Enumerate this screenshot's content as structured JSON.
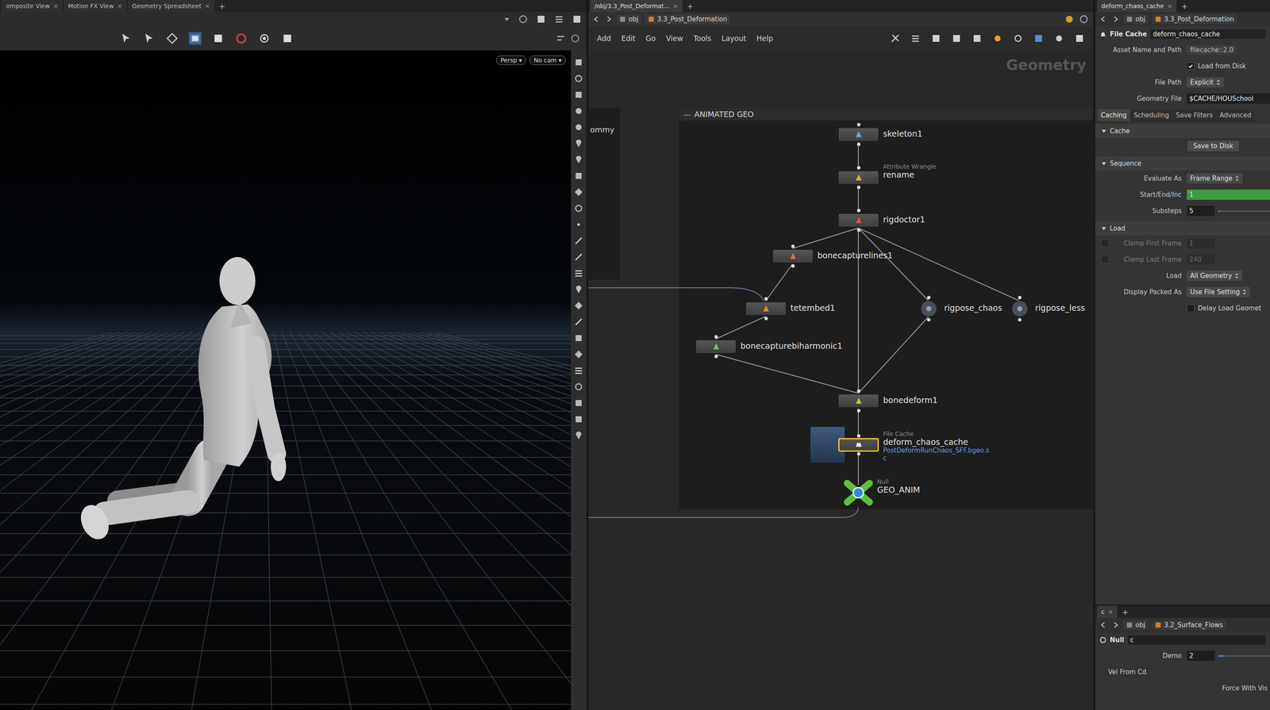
{
  "viewer_tabs": [
    {
      "label": "omposite View",
      "selected": false
    },
    {
      "label": "Motion FX View",
      "selected": false
    },
    {
      "label": "Geometry Spreadsheet",
      "selected": false
    }
  ],
  "tab_close": "×",
  "tab_add": "+",
  "viewport": {
    "view_buttons": [
      {
        "label": "Persp",
        "arrow": "▾"
      },
      {
        "label": "No cam",
        "arrow": "▾"
      }
    ]
  },
  "network": {
    "tab": {
      "label": "/obj/3.3_Post_Deformat...",
      "selected": true
    },
    "path": [
      "obj",
      "3.3_Post_Deformation"
    ],
    "menu": [
      "Add",
      "Edit",
      "Go",
      "View",
      "Tools",
      "Layout",
      "Help"
    ],
    "context": "Geometry",
    "boxes": [
      {
        "title": "ANIMATED GEO",
        "collapse": "—"
      },
      {
        "title": "ommy"
      }
    ],
    "nodes": [
      {
        "name": "skeleton1",
        "type": "",
        "kind": "box",
        "color": "#6fa8d8",
        "selected": false
      },
      {
        "name": "rename",
        "type": "Attribute Wrangle",
        "kind": "box",
        "color": "#e0b040",
        "selected": false
      },
      {
        "name": "rigdoctor1",
        "type": "",
        "kind": "box",
        "color": "#e05050",
        "selected": false
      },
      {
        "name": "bonecapturelines1",
        "type": "",
        "kind": "box",
        "color": "#e06a4a",
        "selected": false
      },
      {
        "name": "tetembed1",
        "type": "",
        "kind": "box",
        "color": "#e08a30",
        "selected": false
      },
      {
        "name": "rigpose_chaos",
        "type": "",
        "kind": "circle",
        "color": "#8aa0c0",
        "selected": false
      },
      {
        "name": "rigpose_less",
        "type": "",
        "kind": "circle",
        "color": "#8aa0c0",
        "selected": false
      },
      {
        "name": "bonecapturebiharmonic1",
        "type": "",
        "kind": "box",
        "color": "#7ac060",
        "selected": false
      },
      {
        "name": "bonedeform1",
        "type": "",
        "kind": "box",
        "color": "#b8c840",
        "selected": false
      },
      {
        "name": "deform_chaos_cache",
        "type": "File Cache",
        "kind": "cache",
        "color": "#e8e8e8",
        "selected": true,
        "file_lines": [
          "PostDeformRunChaos_SFF.bgeo.s",
          "c"
        ]
      },
      {
        "name": "GEO_ANIM",
        "type": "Null",
        "kind": "null",
        "color": "#5cc03c",
        "selected": false
      }
    ],
    "edges": [
      {
        "from": "skeleton1",
        "to": "rename"
      },
      {
        "from": "rename",
        "to": "rigdoctor1"
      },
      {
        "from": "rigdoctor1",
        "to": "bonecapturelines1"
      },
      {
        "from": "bonecapturelines1",
        "to": "tetembed1"
      },
      {
        "from": "tetembed1",
        "to": "bonecapturebiharmonic1"
      },
      {
        "from": "bonecapturebiharmonic1",
        "to": "bonedeform1"
      },
      {
        "from": "rigdoctor1",
        "to": "bonedeform1"
      },
      {
        "from": "rigdoctor1",
        "to": "rigpose_chaos"
      },
      {
        "from": "rigdoctor1",
        "to": "rigpose_less"
      },
      {
        "from": "rigpose_chaos",
        "to": "bonedeform1"
      },
      {
        "from": "bonedeform1",
        "to": "deform_chaos_cache"
      },
      {
        "from": "deform_chaos_cache",
        "to": "GEO_ANIM"
      }
    ]
  },
  "params": {
    "tab": {
      "label": "deform_chaos_cache",
      "selected": true
    },
    "path": [
      "obj",
      "3.3_Post_Deformation"
    ],
    "node_type": "File Cache",
    "node_name": "deform_chaos_cache",
    "header_rows": [
      {
        "kind": "plain",
        "label": "Asset Name and Path",
        "value": "filecache::2.0"
      },
      {
        "kind": "check",
        "label": "",
        "value": "Load from Disk",
        "checked": true
      },
      {
        "kind": "menu",
        "label": "File Path",
        "value": "Explicit"
      },
      {
        "kind": "field",
        "label": "Geometry File",
        "value": "$CACHE/HOUSchool"
      }
    ],
    "tabs": [
      {
        "label": "Caching",
        "selected": true
      },
      {
        "label": "Scheduling",
        "selected": false
      },
      {
        "label": "Save Filters",
        "selected": false
      },
      {
        "label": "Advanced",
        "selected": false
      }
    ],
    "sections": [
      {
        "title": "Cache",
        "expanded": true,
        "rows": [
          {
            "kind": "button",
            "label": "",
            "value": "Save to Disk"
          }
        ]
      },
      {
        "title": "Sequence",
        "expanded": true,
        "rows": [
          {
            "kind": "menu",
            "label": "Evaluate As",
            "value": "Frame Range"
          },
          {
            "kind": "field",
            "label": "Start/End/Inc",
            "value": "1",
            "color": "#3c9a40"
          },
          {
            "kind": "slider",
            "label": "Substeps",
            "value": "5",
            "level": 0.04
          }
        ]
      },
      {
        "title": "Load",
        "expanded": true,
        "rows": [
          {
            "kind": "check_field",
            "label": "Clamp First Frame",
            "value": "1",
            "checked": false,
            "disabled": true
          },
          {
            "kind": "check_field",
            "label": "Clamp Last Frame",
            "value": "240",
            "checked": false,
            "disabled": true
          },
          {
            "kind": "menu",
            "label": "Load",
            "value": "All Geometry"
          },
          {
            "kind": "menu",
            "label": "Display Packed As",
            "value": "Use File Setting"
          },
          {
            "kind": "check",
            "label": "",
            "value": "Delay Load Geomet",
            "checked": false
          }
        ]
      }
    ]
  },
  "bottom": {
    "tab": {
      "label": "c",
      "selected": true
    },
    "path": [
      "obj",
      "3.2_Surface_Flows"
    ],
    "node_type": "Null",
    "node_name": "c",
    "rows": [
      {
        "kind": "slider",
        "label": "Demo",
        "value": "2",
        "level": 0.1
      },
      {
        "kind": "text",
        "label": "Vel From Cd"
      },
      {
        "kind": "text_right",
        "label": "Force With Vis"
      }
    ]
  }
}
